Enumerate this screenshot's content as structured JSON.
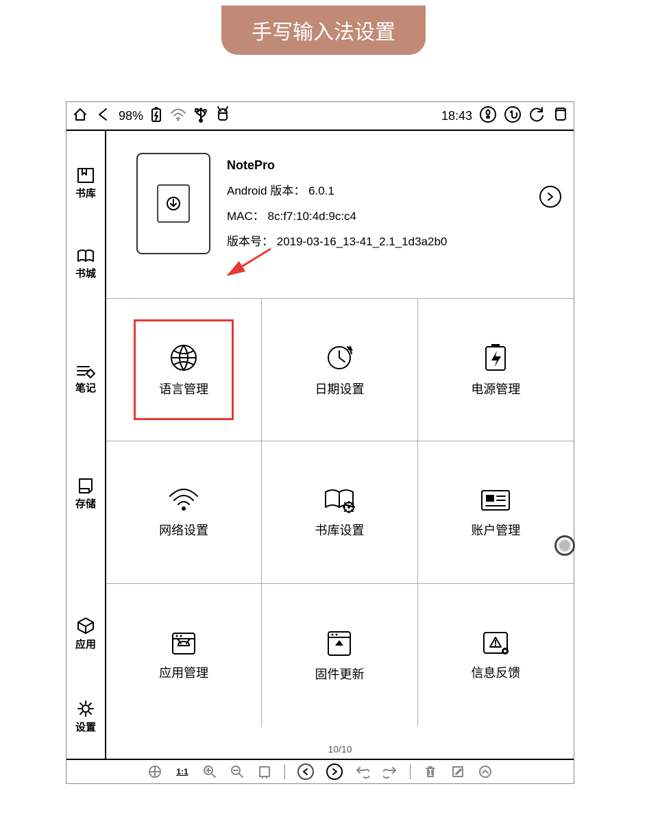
{
  "header": {
    "title": "手写输入法设置"
  },
  "statusbar": {
    "battery_pct": "98%",
    "time": "18:43"
  },
  "sidebar": {
    "items": [
      {
        "label": "书库",
        "name": "library"
      },
      {
        "label": "书城",
        "name": "store"
      },
      {
        "label": "笔记",
        "name": "notes"
      },
      {
        "label": "存储",
        "name": "storage"
      },
      {
        "label": "应用",
        "name": "apps"
      },
      {
        "label": "设置",
        "name": "settings"
      }
    ]
  },
  "device_info": {
    "title": "NotePro",
    "android_label": "Android 版本：",
    "android_version": "6.0.1",
    "mac_label": "MAC：",
    "mac": "8c:f7:10:4d:9c:c4",
    "build_label": "版本号：",
    "build": "2019-03-16_13-41_2.1_1d3a2b0"
  },
  "settings_grid": {
    "items": [
      {
        "label": "语言管理",
        "icon": "globe-icon",
        "highlight": true
      },
      {
        "label": "日期设置",
        "icon": "clock-icon"
      },
      {
        "label": "电源管理",
        "icon": "power-icon"
      },
      {
        "label": "网络设置",
        "icon": "wifi-icon"
      },
      {
        "label": "书库设置",
        "icon": "library-settings-icon"
      },
      {
        "label": "账户管理",
        "icon": "account-icon"
      },
      {
        "label": "应用管理",
        "icon": "apps-manage-icon"
      },
      {
        "label": "固件更新",
        "icon": "firmware-update-icon"
      },
      {
        "label": "信息反馈",
        "icon": "feedback-icon"
      }
    ]
  },
  "pagination": {
    "text": "10/10"
  }
}
